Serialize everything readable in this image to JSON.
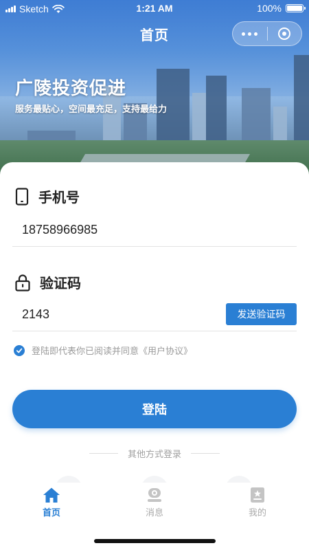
{
  "status_bar": {
    "carrier": "Sketch",
    "time": "1:21 AM",
    "battery": "100%",
    "battery_level": 1.0
  },
  "nav": {
    "title": "首页"
  },
  "hero": {
    "title": "广陵投资促进",
    "subtitle": "服务最贴心，空间最充足，支持最给力"
  },
  "phone": {
    "label": "手机号",
    "value": "18758966985"
  },
  "code": {
    "label": "验证码",
    "value": "2143",
    "send_label": "发送验证码"
  },
  "agreement": {
    "checked": true,
    "text": "登陆即代表你已阅读并同意《用户协议》"
  },
  "login_label": "登陆",
  "other_login_label": "其他方式登录",
  "tabs": [
    {
      "label": "首页",
      "icon": "home-icon",
      "active": true
    },
    {
      "label": "消息",
      "icon": "message-icon",
      "active": false
    },
    {
      "label": "我的",
      "icon": "profile-icon",
      "active": false
    }
  ],
  "colors": {
    "primary": "#2a7fd4",
    "inactive": "#aaaaaa"
  }
}
